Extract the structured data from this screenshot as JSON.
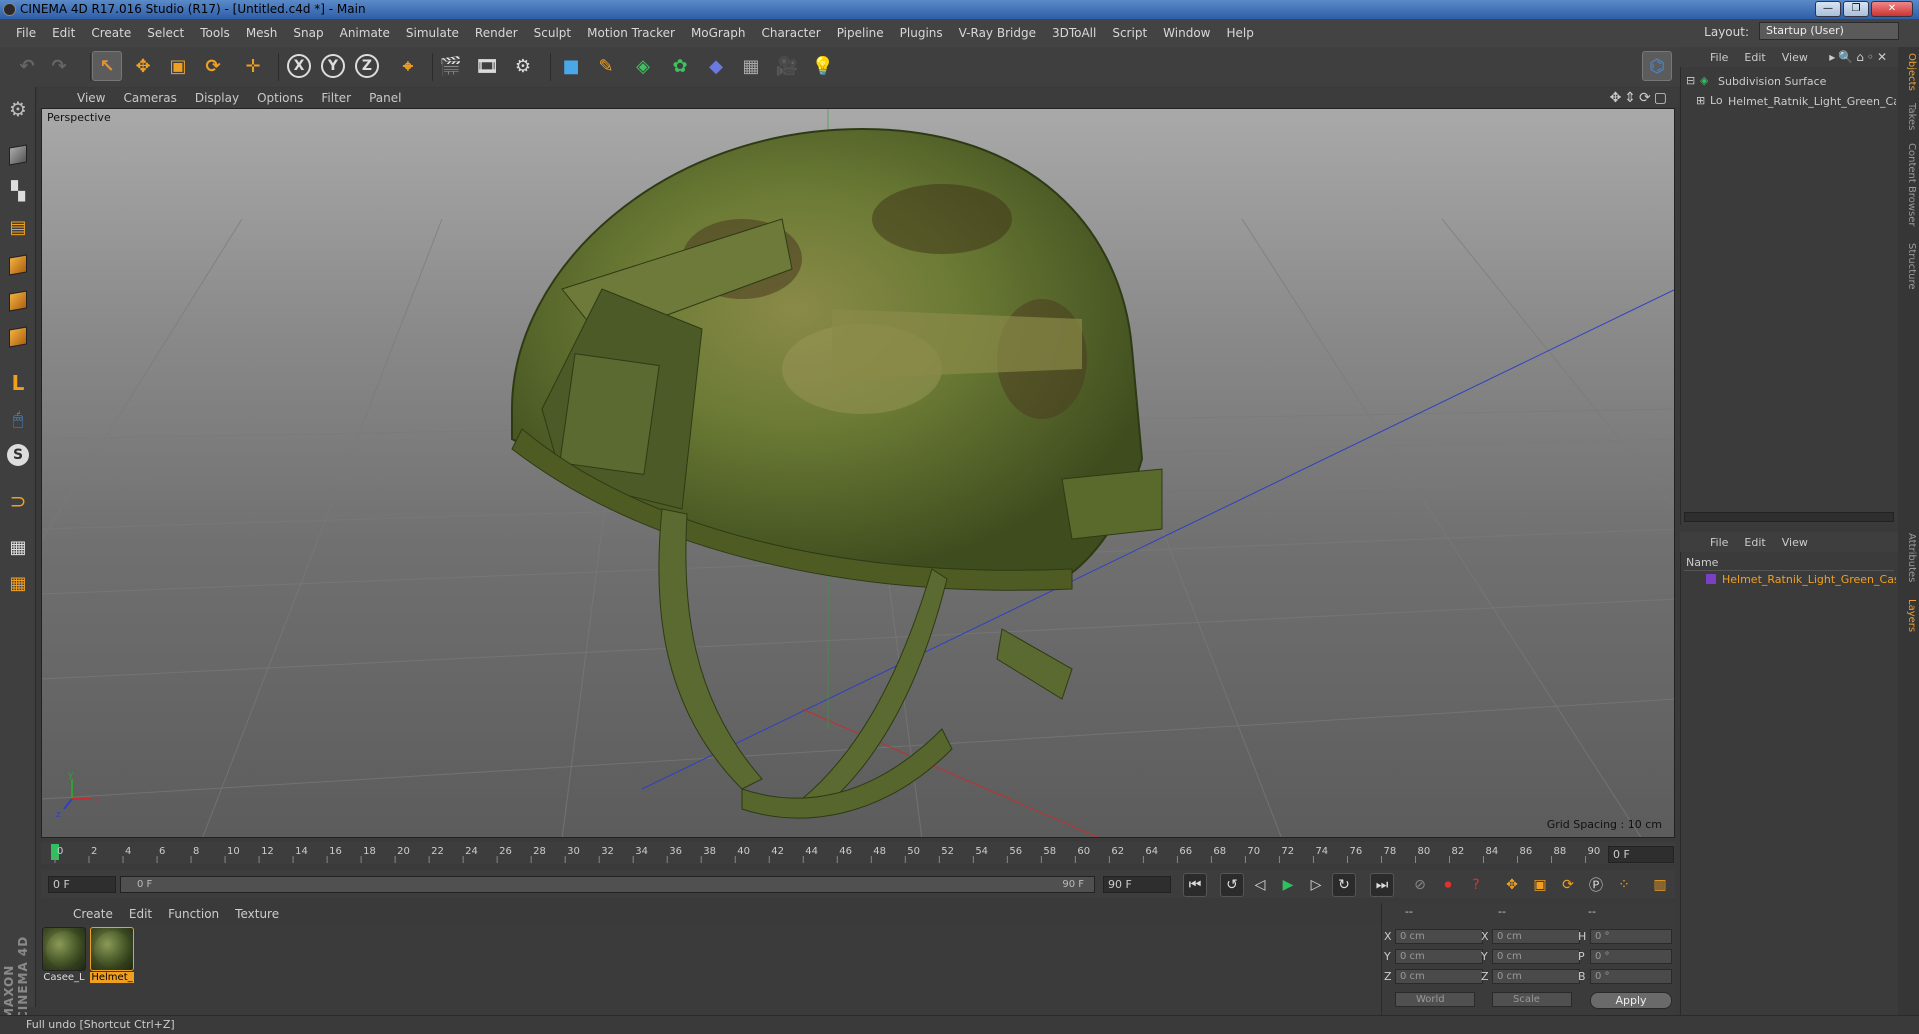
{
  "title": "CINEMA 4D R17.016 Studio (R17) - [Untitled.c4d *] - Main",
  "window_buttons": [
    "—",
    "❐",
    "✕"
  ],
  "menu": [
    "File",
    "Edit",
    "Create",
    "Select",
    "Tools",
    "Mesh",
    "Snap",
    "Animate",
    "Simulate",
    "Render",
    "Sculpt",
    "Motion Tracker",
    "MoGraph",
    "Character",
    "Pipeline",
    "Plugins",
    "V-Ray Bridge",
    "3DToAll",
    "Script",
    "Window",
    "Help"
  ],
  "layout": {
    "label": "Layout:",
    "value": "Startup (User)"
  },
  "toolbar": {
    "x_label": "X",
    "y_label": "Y",
    "z_label": "Z"
  },
  "viewport": {
    "menu": [
      "View",
      "Cameras",
      "Display",
      "Options",
      "Filter",
      "Panel"
    ],
    "label": "Perspective",
    "grid_spacing": "Grid Spacing : 10 cm",
    "axis_x": "x",
    "axis_y": "y",
    "axis_z": "z"
  },
  "timeline": {
    "ticks": [
      "0",
      "2",
      "4",
      "6",
      "8",
      "10",
      "12",
      "14",
      "16",
      "18",
      "20",
      "22",
      "24",
      "26",
      "28",
      "30",
      "32",
      "34",
      "36",
      "38",
      "40",
      "42",
      "44",
      "46",
      "48",
      "50",
      "52",
      "54",
      "56",
      "58",
      "60",
      "62",
      "64",
      "66",
      "68",
      "70",
      "72",
      "74",
      "76",
      "78",
      "80",
      "82",
      "84",
      "86",
      "88",
      "90"
    ],
    "current_frame": "0 F",
    "start_field": "0 F",
    "range_start": "0 F",
    "range_end": "90 F",
    "end_field": "90 F"
  },
  "materials": {
    "menu": [
      "Create",
      "Edit",
      "Function",
      "Texture"
    ],
    "items": [
      {
        "label": "Casee_L",
        "selected": false
      },
      {
        "label": "Helmet_",
        "selected": true
      }
    ]
  },
  "coordinates": {
    "header": [
      "--",
      "--",
      "--"
    ],
    "rows": [
      {
        "a": "X",
        "av": "0 cm",
        "b": "X",
        "bv": "0 cm",
        "c": "H",
        "cv": "0 °"
      },
      {
        "a": "Y",
        "av": "0 cm",
        "b": "Y",
        "bv": "0 cm",
        "c": "P",
        "cv": "0 °"
      },
      {
        "a": "Z",
        "av": "0 cm",
        "b": "Z",
        "bv": "0 cm",
        "c": "B",
        "cv": "0 °"
      }
    ],
    "mode": "World",
    "type": "Scale",
    "apply": "Apply"
  },
  "status": "Full undo [Shortcut Ctrl+Z]",
  "object_manager": {
    "menu": [
      "File",
      "Edit",
      "View"
    ],
    "items": [
      "Subdivision Surface",
      "Helmet_Ratnik_Light_Green_Case"
    ]
  },
  "layer_manager": {
    "menu": [
      "File",
      "Edit",
      "View"
    ],
    "column": "Name",
    "items": [
      "Helmet_Ratnik_Light_Green_Case"
    ]
  },
  "side_tabs": [
    "Objects",
    "Takes",
    "Content Browser",
    "Structure",
    "Attributes",
    "Layers"
  ],
  "brand": "MAXON CINEMA 4D",
  "colors": {
    "accent": "#f0a020",
    "layer_color": "#7b3fc4",
    "axis_x": "#c03030",
    "axis_y": "#30a030",
    "axis_z": "#3040c0",
    "helmet_green": "#5a6a2c"
  }
}
